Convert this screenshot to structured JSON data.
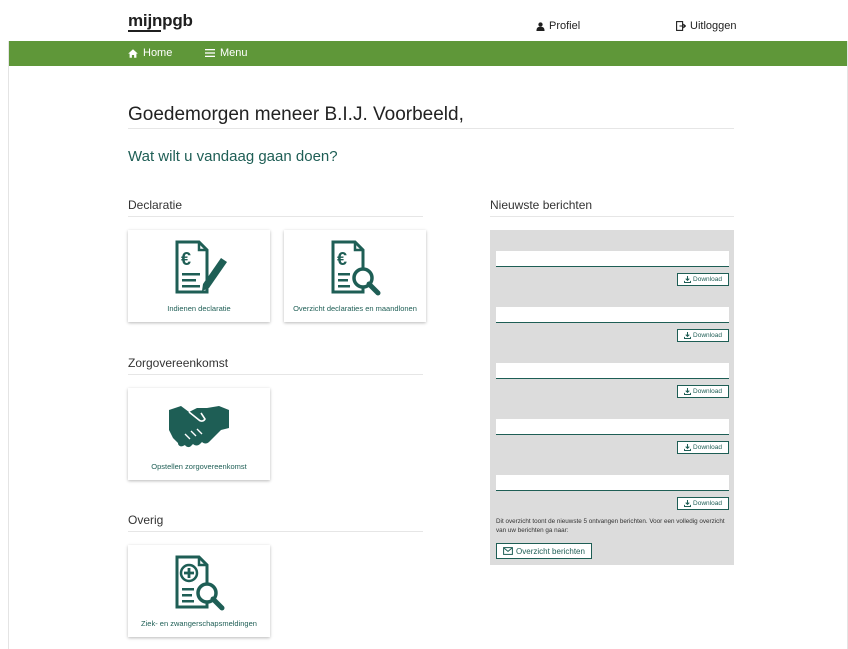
{
  "brand": {
    "logo_text": "mijnpgb",
    "color_primary": "#1e5e55",
    "color_nav": "#5f9739"
  },
  "topbar": {
    "profile_label": "Profiel",
    "logout_label": "Uitloggen"
  },
  "nav": {
    "home_label": "Home",
    "menu_label": "Menu"
  },
  "greeting": "Goedemorgen meneer B.I.J. Voorbeeld,",
  "subheading": "Wat wilt u vandaag gaan doen?",
  "sections": {
    "declaratie": {
      "title": "Declaratie",
      "tiles": [
        {
          "label": "Indienen declaratie",
          "icon": "euro-document-pen-icon"
        },
        {
          "label": "Overzicht declaraties en maandlonen",
          "icon": "euro-document-search-icon"
        }
      ]
    },
    "zorgovereenkomst": {
      "title": "Zorgovereenkomst",
      "tiles": [
        {
          "label": "Opstellen zorgovereenkomst",
          "icon": "handshake-icon"
        }
      ]
    },
    "overig": {
      "title": "Overig",
      "tiles": [
        {
          "label": "Ziek- en zwangerschapsmeldingen",
          "icon": "medical-document-search-icon"
        }
      ]
    }
  },
  "messages": {
    "title": "Nieuwste berichten",
    "download_label": "Download",
    "items": [
      "",
      "",
      "",
      "",
      ""
    ],
    "note": "Dit overzicht toont de nieuwste 5 ontvangen berichten. Voor een volledig overzicht van uw berichten ga naar:",
    "overview_button": "Overzicht berichten"
  }
}
